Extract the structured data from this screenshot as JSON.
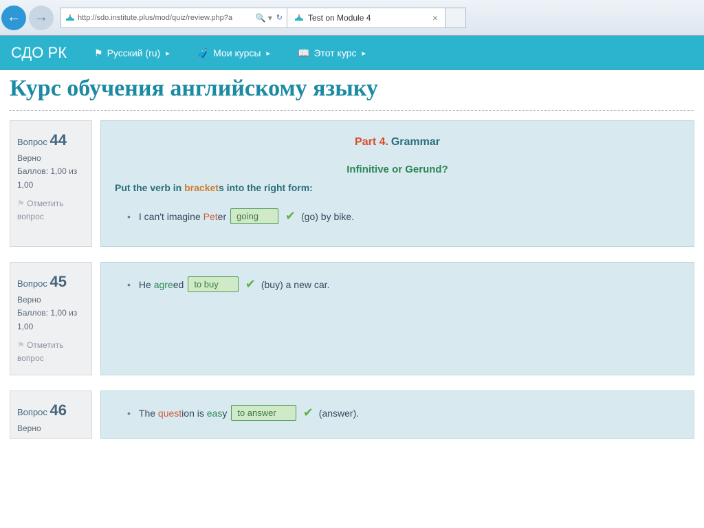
{
  "browser": {
    "url": "http://sdo.institute.plus/mod/quiz/review.php?a",
    "search_hint": "🔍",
    "refresh_hint": "↻",
    "tab_title": "Test on Module 4",
    "tab_close": "×",
    "back": "←",
    "forward": "→"
  },
  "nav": {
    "brand": "СДО РК",
    "lang_label": "Русский (ru)",
    "my_courses": "Мои курсы",
    "this_course": "Этот курс"
  },
  "page": {
    "title": "Курс обучения английскому языку"
  },
  "side": {
    "question_label": "Вопрос",
    "correct": "Верно",
    "score": "Баллов: 1,00 из 1,00",
    "score_line1": "Баллов: 1,00 из",
    "score_line2": "1,00",
    "flag": "Отметить вопрос",
    "flag_line1": "Отметить",
    "flag_line2": "вопрос"
  },
  "q44": {
    "num": "44",
    "part_prefix": "Part 4.",
    "part_title": "Grammar",
    "subhead": "Infinitive or Gerund?",
    "instr_a": "Put the verb in ",
    "instr_b": "bracket",
    "instr_c": "s into the right form:",
    "s1_a": "I can't imagine ",
    "s1_b": "Pet",
    "s1_c": "er",
    "answer": "going",
    "hint": "(go) by bike."
  },
  "q45": {
    "num": "45",
    "s_a": "He ",
    "s_b": "agre",
    "s_c": "ed",
    "answer": "to buy",
    "hint": "(buy) a new car."
  },
  "q46": {
    "num": "46",
    "s_a": "The ",
    "s_b": "quest",
    "s_c": "ion is ",
    "s_d": "eas",
    "s_e": "y",
    "answer": "to answer",
    "hint": "(answer)."
  }
}
